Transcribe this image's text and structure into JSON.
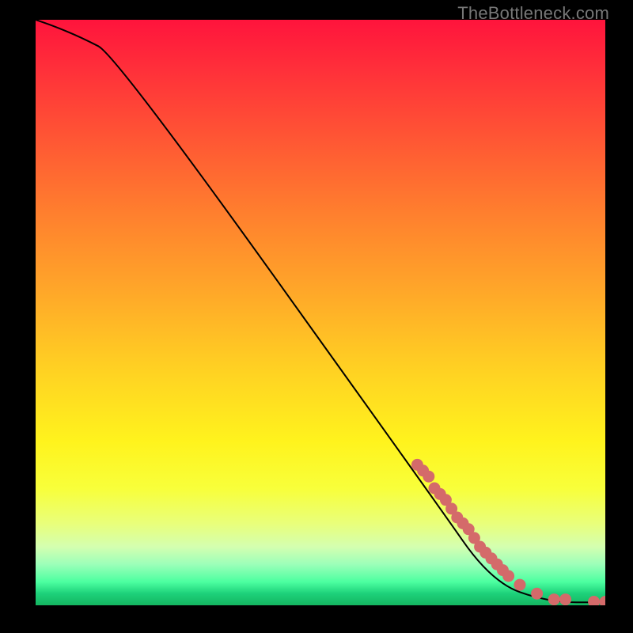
{
  "watermark": "TheBottleneck.com",
  "colors": {
    "frame_bg": "#000000",
    "marker": "#d46a6a",
    "curve": "#000000"
  },
  "chart_data": {
    "type": "line",
    "title": "",
    "xlabel": "",
    "ylabel": "",
    "xlim": [
      0,
      100
    ],
    "ylim": [
      0,
      100
    ],
    "series": [
      {
        "name": "bottleneck-curve",
        "x": [
          0,
          3,
          8,
          14,
          70,
          80,
          90,
          100
        ],
        "y": [
          100,
          99,
          97,
          94,
          18,
          4,
          0.5,
          0.5
        ]
      }
    ],
    "markers": {
      "name": "data-points",
      "x": [
        67,
        68,
        69,
        70,
        71,
        72,
        73,
        74,
        75,
        76,
        77,
        78,
        79,
        80,
        81,
        82,
        83,
        85,
        88,
        91,
        93,
        98,
        100
      ],
      "y": [
        24,
        23,
        22,
        20,
        19,
        18,
        16.5,
        15,
        14,
        13,
        11.5,
        10,
        9,
        8,
        7,
        6,
        5,
        3.5,
        2,
        1,
        1,
        0.6,
        0.6
      ]
    }
  }
}
